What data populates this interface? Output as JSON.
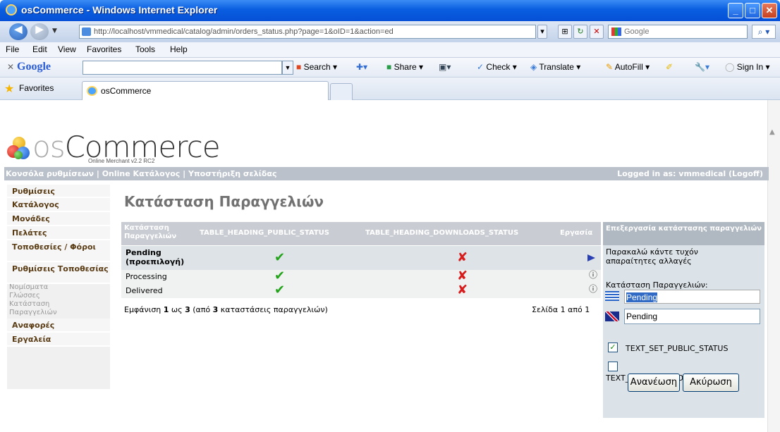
{
  "window": {
    "title": "osCommerce - Windows Internet Explorer"
  },
  "address_bar": {
    "url": "http://localhost/vmmedical/catalog/admin/orders_status.php?page=1&oID=1&action=ed",
    "search_placeholder": "Google"
  },
  "menu": [
    "File",
    "Edit",
    "View",
    "Favorites",
    "Tools",
    "Help"
  ],
  "google_toolbar": {
    "logo": "Google",
    "items": [
      "Search ▾",
      "Share ▾",
      "Check ▾",
      "Translate ▾",
      "AutoFill ▾",
      "Sign In ▾"
    ]
  },
  "favorites_bar": {
    "favorites": "Favorites",
    "tab_title": "osCommerce"
  },
  "logo": {
    "os": "os",
    "commerce": "Commerce",
    "tagline": "Online Merchant v2.2 RC2"
  },
  "header_bar": {
    "left": "Κονσόλα ρυθμίσεων | Online Κατάλογος | Υποστήριξη σελίδας",
    "right": "Logged in as: vmmedical (Logoff)"
  },
  "nav": {
    "settings": "Ρυθμίσεις",
    "catalog": "Κατάλογος",
    "modules": "Μονάδες",
    "customers": "Πελάτες",
    "locations": "Τοποθεσίες / Φόροι",
    "localization": "Ρυθμίσεις Τοποθεσίας",
    "sub": [
      "Νομίσματα",
      "Γλώσσες",
      "Κατάσταση Παραγγελιών"
    ],
    "reports": "Αναφορές",
    "tools": "Εργαλεία"
  },
  "page_title": "Κατάσταση Παραγγελιών",
  "table": {
    "headers": [
      "Κατάσταση Παραγγελιών",
      "TABLE_HEADING_PUBLIC_STATUS",
      "TABLE_HEADING_DOWNLOADS_STATUS",
      "Εργασία"
    ],
    "rows": [
      {
        "name": "Pending (προεπιλογή)",
        "public": true,
        "downloads": false,
        "action": "selected"
      },
      {
        "name": "Processing",
        "public": true,
        "downloads": false,
        "action": "info"
      },
      {
        "name": "Delivered",
        "public": true,
        "downloads": false,
        "action": "info"
      }
    ],
    "footer_prefix": "Εμφάνιση ",
    "footer_from": "1",
    "footer_mid": " ως ",
    "footer_to": "3",
    "footer_of": " (από ",
    "footer_total": "3",
    "footer_suffix": " καταστάσεις παραγγελιών)",
    "pager": "Σελίδα 1 από 1"
  },
  "edit_box": {
    "heading": "Επεξεργασία κατάστασης παραγγελιών",
    "intro": "Παρακαλώ κάντε τυχόν απαραίτητες αλλαγές",
    "label": "Κατάσταση Παραγγελιών:",
    "value_gr": "Pending",
    "value_en": "Pending",
    "public_label": "TEXT_SET_PUBLIC_STATUS",
    "public_checked": true,
    "downloads_label": "TEXT_SET_DOWNLOADS_STATUS",
    "downloads_checked": false,
    "update": "Ανανέωση",
    "cancel": "Ακύρωση"
  }
}
